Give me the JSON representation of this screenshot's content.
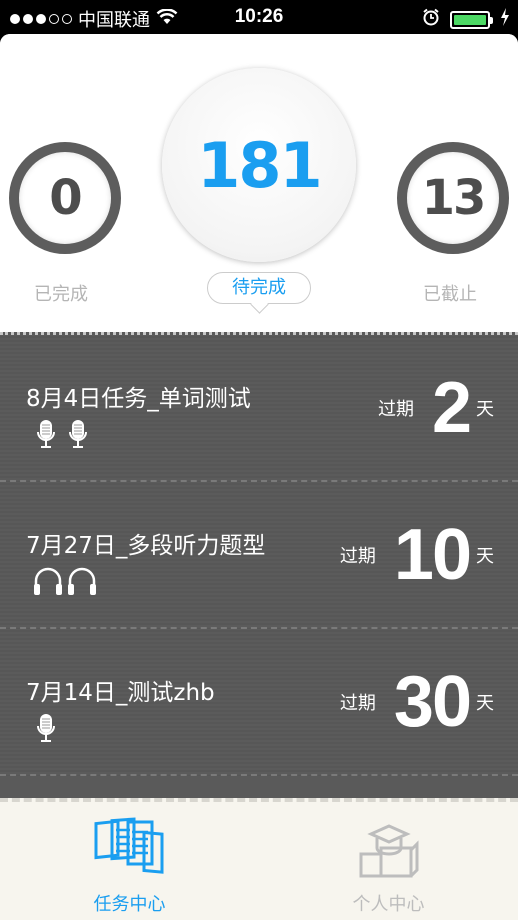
{
  "status_bar": {
    "carrier": "中国联通",
    "time": "10:26",
    "signal_dots_filled": 3,
    "signal_dots_total": 5,
    "battery_level": 1.0
  },
  "summary": {
    "done_count": "0",
    "done_label": "已完成",
    "pending_count": "181",
    "pending_label": "待完成",
    "expired_count": "13",
    "expired_label": "已截止"
  },
  "tasks": [
    {
      "title": "8月4日任务_单词测试",
      "overdue_label": "过期",
      "overdue_days": "2",
      "unit": "天",
      "icons": [
        "microphone-icon",
        "microphone-icon"
      ]
    },
    {
      "title": "7月27日_多段听力题型",
      "overdue_label": "过期",
      "overdue_days": "10",
      "unit": "天",
      "icons": [
        "headphones-icon",
        "headphones-icon"
      ]
    },
    {
      "title": "7月14日_测试zhb",
      "overdue_label": "过期",
      "overdue_days": "30",
      "unit": "天",
      "icons": [
        "microphone-icon"
      ]
    }
  ],
  "tab_bar": {
    "tasks_label": "任务中心",
    "profile_label": "个人中心"
  },
  "colors": {
    "accent": "#1a9ef0",
    "ring": "#5d5d5d",
    "list_bg": "#5a5a5a",
    "battery": "#4cd964"
  }
}
